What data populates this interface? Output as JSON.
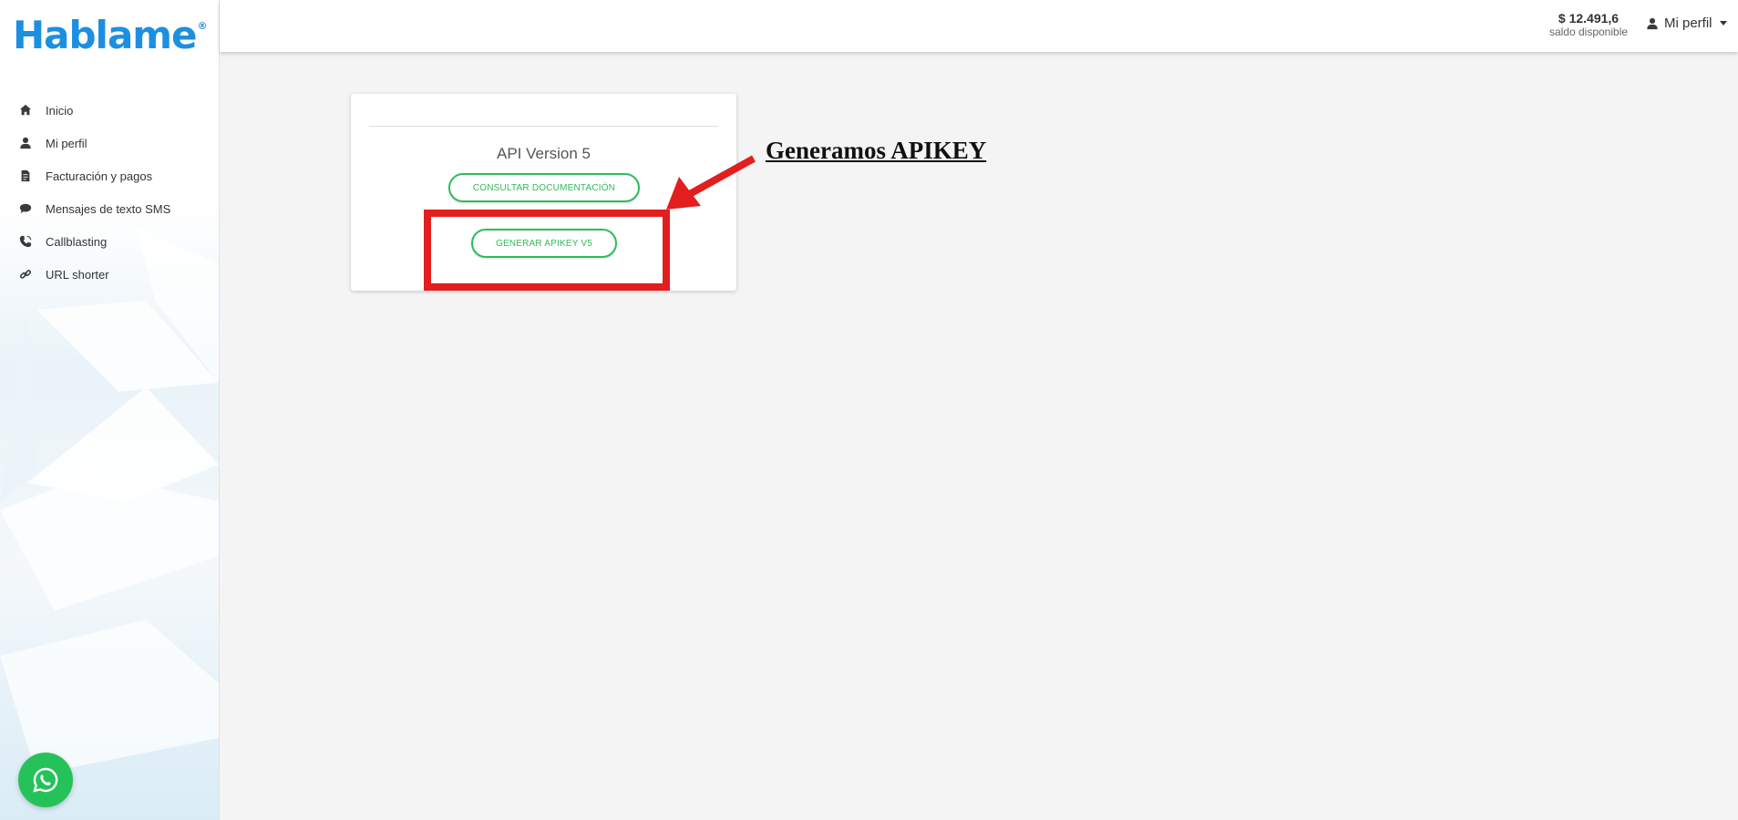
{
  "brand": {
    "name": "Hablame",
    "registered": "®",
    "color": "#1d8fe0"
  },
  "sidebar": {
    "items": [
      {
        "label": "Inicio",
        "icon": "home-icon"
      },
      {
        "label": "Mi perfil",
        "icon": "user-icon"
      },
      {
        "label": "Facturación y pagos",
        "icon": "invoice-icon"
      },
      {
        "label": "Mensajes de texto SMS",
        "icon": "chat-icon"
      },
      {
        "label": "Callblasting",
        "icon": "phone-icon"
      },
      {
        "label": "URL shorter",
        "icon": "link-icon"
      }
    ],
    "whatsapp_icon": "whatsapp-icon"
  },
  "header": {
    "balance_amount": "$ 12.491,6",
    "balance_label": "saldo disponible",
    "profile_label": "Mi perfil"
  },
  "card": {
    "title": "API Version 5",
    "docs_button": "CONSULTAR DOCUMENTACIÓN",
    "apikey_button": "GENERAR APIKEY V5"
  },
  "annotation": {
    "text": "Generamos APIKEY",
    "color": "#e31e1e"
  },
  "colors": {
    "accent_green": "#2ebd59",
    "whatsapp_green": "#25c25a",
    "background": "#f4f4f4"
  }
}
